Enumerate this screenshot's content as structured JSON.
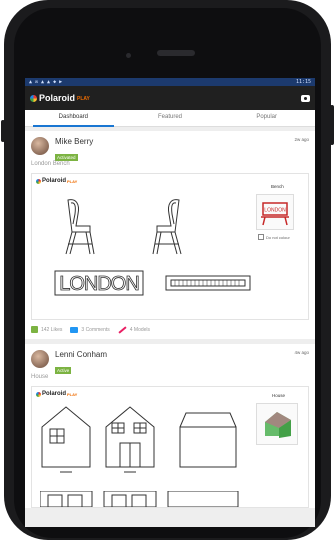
{
  "app": {
    "brand_name": "Polaroid",
    "brand_suffix": "PLAY",
    "status_time": "11:15"
  },
  "tabs": [
    {
      "label": "Dashboard"
    },
    {
      "label": "Featured"
    },
    {
      "label": "Popular"
    }
  ],
  "posts": [
    {
      "user_name": "Mike Berry",
      "status": "Activated",
      "time_ago": "2w ago",
      "title": "London Bench",
      "box_brand": "Polaroid",
      "box_brand_suffix": "PLAY",
      "model_label": "Bench",
      "do_not_colour": "Do not colour",
      "stencil_text": "LONDON",
      "likes": "142 Likes",
      "comments": "3 Comments",
      "models": "4 Models"
    },
    {
      "user_name": "Lenni Conham",
      "status": "Active",
      "time_ago": "4w ago",
      "title": "House",
      "box_brand": "Polaroid",
      "box_brand_suffix": "PLAY",
      "model_label": "House"
    }
  ],
  "colors": {
    "status_bar": "#1c3a6e",
    "app_bar": "#202020",
    "tab_indicator": "#1976d2",
    "badge": "#7cb342",
    "like_icon": "#7cb342",
    "comment_icon": "#2196f3",
    "models_icon": "#e91e63"
  }
}
